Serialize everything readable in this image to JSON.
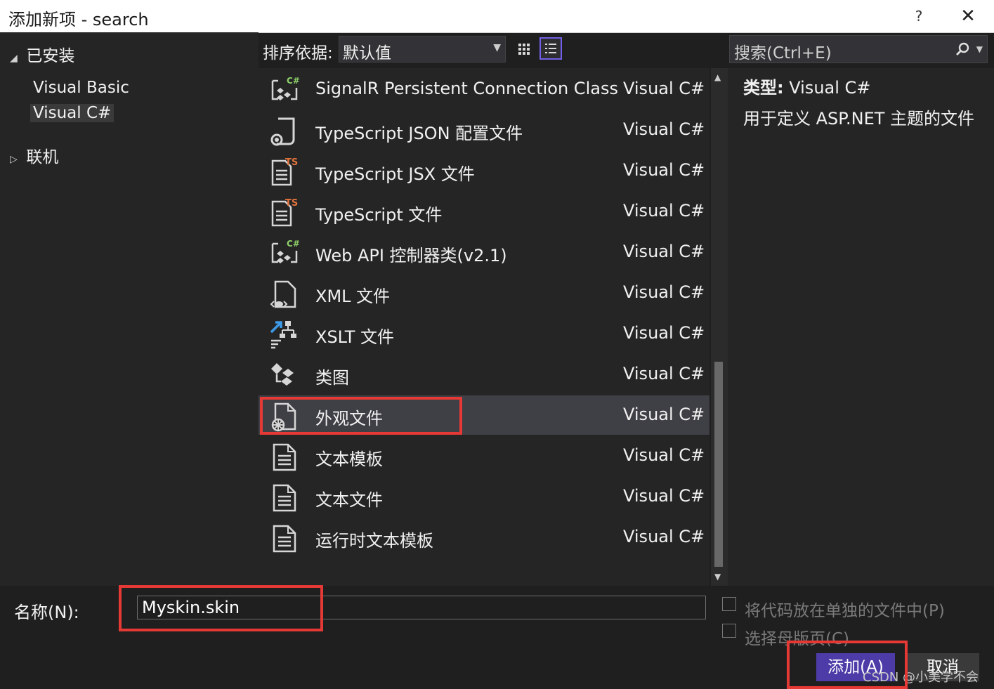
{
  "window": {
    "title": "添加新项 - search",
    "help": "?",
    "close": "✕"
  },
  "tree": {
    "installed": "已安装",
    "items": [
      "Visual Basic",
      "Visual C#"
    ],
    "online": "联机"
  },
  "toolbar": {
    "sort_label": "排序依据:",
    "sort_value": "默认值"
  },
  "search": {
    "placeholder": "搜索(Ctrl+E)"
  },
  "templates": [
    {
      "name": "SignalR Persistent Connection Class...",
      "language": "Visual C#",
      "icon": "csharp-class-icon"
    },
    {
      "name": "TypeScript JSON 配置文件",
      "language": "Visual C#",
      "icon": "json-config-icon"
    },
    {
      "name": "TypeScript JSX 文件",
      "language": "Visual C#",
      "icon": "typescript-file-icon"
    },
    {
      "name": "TypeScript 文件",
      "language": "Visual C#",
      "icon": "typescript-file-icon"
    },
    {
      "name": "Web API 控制器类(v2.1)",
      "language": "Visual C#",
      "icon": "csharp-class-icon"
    },
    {
      "name": "XML 文件",
      "language": "Visual C#",
      "icon": "xml-file-icon"
    },
    {
      "name": "XSLT 文件",
      "language": "Visual C#",
      "icon": "xslt-file-icon"
    },
    {
      "name": "类图",
      "language": "Visual C#",
      "icon": "class-diagram-icon"
    },
    {
      "name": "外观文件",
      "language": "Visual C#",
      "icon": "skin-file-icon",
      "selected": true
    },
    {
      "name": "文本模板",
      "language": "Visual C#",
      "icon": "text-file-icon"
    },
    {
      "name": "文本文件",
      "language": "Visual C#",
      "icon": "text-file-icon"
    },
    {
      "name": "运行时文本模板",
      "language": "Visual C#",
      "icon": "text-file-icon"
    }
  ],
  "details": {
    "type_label": "类型:",
    "type_value": "Visual C#",
    "description": "用于定义 ASP.NET 主题的文件"
  },
  "bottom": {
    "name_label": "名称(N):",
    "name_value": "Myskin.skin",
    "option1": "将代码放在单独的文件中(P)",
    "option2": "选择母版页(C)",
    "add_button": "添加(A)",
    "cancel_button": "取消"
  },
  "watermark": "CSDN @小美学不会",
  "colors": {
    "accent": "#4d3ba8",
    "selected_row": "#3f3f46",
    "annotation_red": "#e53935",
    "ts_orange": "#e2733a",
    "csharp_green": "#8fd16a"
  }
}
